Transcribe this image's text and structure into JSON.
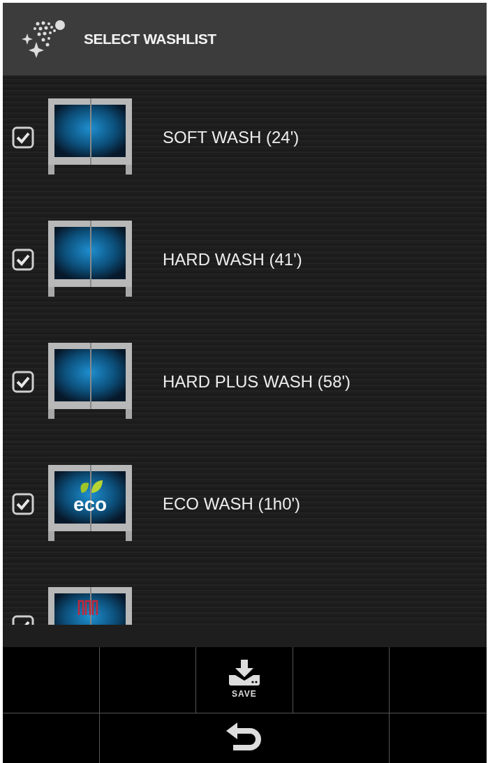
{
  "header": {
    "title": "SELECT WASHLIST"
  },
  "washlist": [
    {
      "label": "SOFT WASH (24')",
      "checked": true,
      "kind": "plain"
    },
    {
      "label": "HARD WASH (41')",
      "checked": true,
      "kind": "plain"
    },
    {
      "label": "HARD PLUS WASH (58')",
      "checked": true,
      "kind": "plain"
    },
    {
      "label": "ECO WASH (1h0')",
      "checked": true,
      "kind": "eco",
      "badge": "eco"
    },
    {
      "checked": true,
      "kind": "grill"
    }
  ],
  "toolbar": {
    "save_label": "SAVE"
  }
}
